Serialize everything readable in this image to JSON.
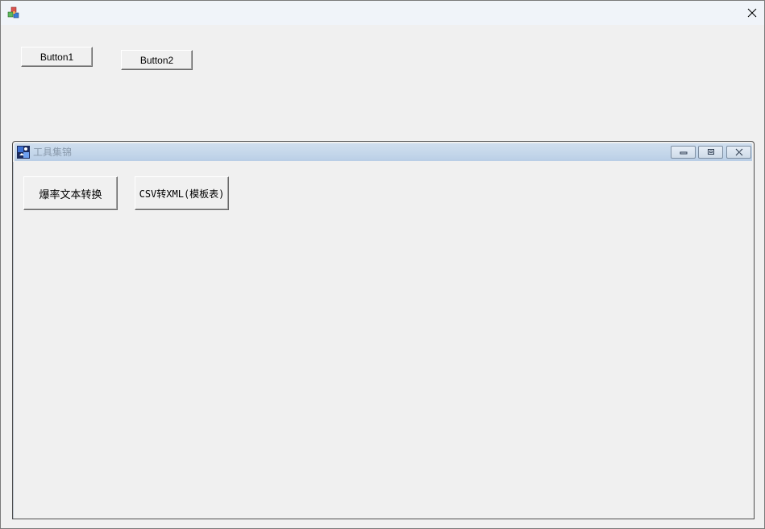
{
  "window": {
    "title": "",
    "icon": "app-cubes-icon",
    "close_icon": "close-icon"
  },
  "main": {
    "button1_label": "Button1",
    "button2_label": "Button2"
  },
  "child_window": {
    "title": "工具集锦",
    "icon": "child-app-icon",
    "controls": [
      "minimize-icon",
      "restore-icon",
      "close-icon"
    ],
    "tools": [
      {
        "label": "爆率文本转换"
      },
      {
        "label": "CSV转XML(模板表)"
      }
    ]
  },
  "colors": {
    "titlebar": "#f0f4f9",
    "background": "#f0f0f0",
    "child_titlebar": "#c4d6ea",
    "child_title_text": "#8a9aac"
  }
}
